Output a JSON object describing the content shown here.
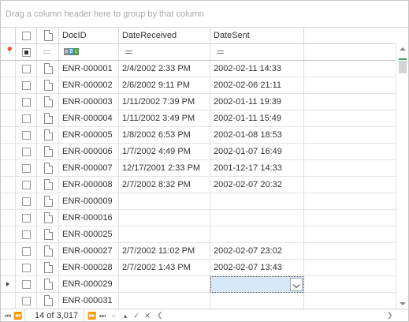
{
  "group_panel": {
    "hint": "Drag a column header here to group by that column"
  },
  "columns": {
    "doc_id": "DocID",
    "date_received": "DateReceived",
    "date_sent": "DateSent"
  },
  "filter_row": {
    "doc_id_icon": "abc-filter-icon",
    "date_icon": "equals-icon"
  },
  "rows": [
    {
      "doc_id": "ENR-000001",
      "date_received": "2/4/2002 2:33 PM",
      "date_sent": "2002-02-11 14:33"
    },
    {
      "doc_id": "ENR-000002",
      "date_received": "2/6/2002 9:11 PM",
      "date_sent": "2002-02-06 21:11"
    },
    {
      "doc_id": "ENR-000003",
      "date_received": "1/11/2002 7:39 PM",
      "date_sent": "2002-01-11 19:39"
    },
    {
      "doc_id": "ENR-000004",
      "date_received": "1/11/2002 3:49 PM",
      "date_sent": "2002-01-11 15:49"
    },
    {
      "doc_id": "ENR-000005",
      "date_received": "1/8/2002 6:53 PM",
      "date_sent": "2002-01-08 18:53"
    },
    {
      "doc_id": "ENR-000006",
      "date_received": "1/7/2002 4:49 PM",
      "date_sent": "2002-01-07 16:49"
    },
    {
      "doc_id": "ENR-000007",
      "date_received": "12/17/2001 2:33 PM",
      "date_sent": "2001-12-17 14:33"
    },
    {
      "doc_id": "ENR-000008",
      "date_received": "2/7/2002 8:32 PM",
      "date_sent": "2002-02-07 20:32"
    },
    {
      "doc_id": "ENR-000009",
      "date_received": "",
      "date_sent": ""
    },
    {
      "doc_id": "ENR-000016",
      "date_received": "",
      "date_sent": ""
    },
    {
      "doc_id": "ENR-000025",
      "date_received": "",
      "date_sent": ""
    },
    {
      "doc_id": "ENR-000027",
      "date_received": "2/7/2002 11:02 PM",
      "date_sent": "2002-02-07 23:02"
    },
    {
      "doc_id": "ENR-000028",
      "date_received": "2/7/2002 1:43 PM",
      "date_sent": "2002-02-07 13:43"
    },
    {
      "doc_id": "ENR-000029",
      "date_received": "",
      "date_sent": "",
      "focused": true
    },
    {
      "doc_id": "ENR-000031",
      "date_received": "",
      "date_sent": ""
    }
  ],
  "navigator": {
    "record_text": "14 of 3,017"
  },
  "colors": {
    "editor_bg": "#d6e8f8",
    "scroll_marker": "#31a354"
  }
}
